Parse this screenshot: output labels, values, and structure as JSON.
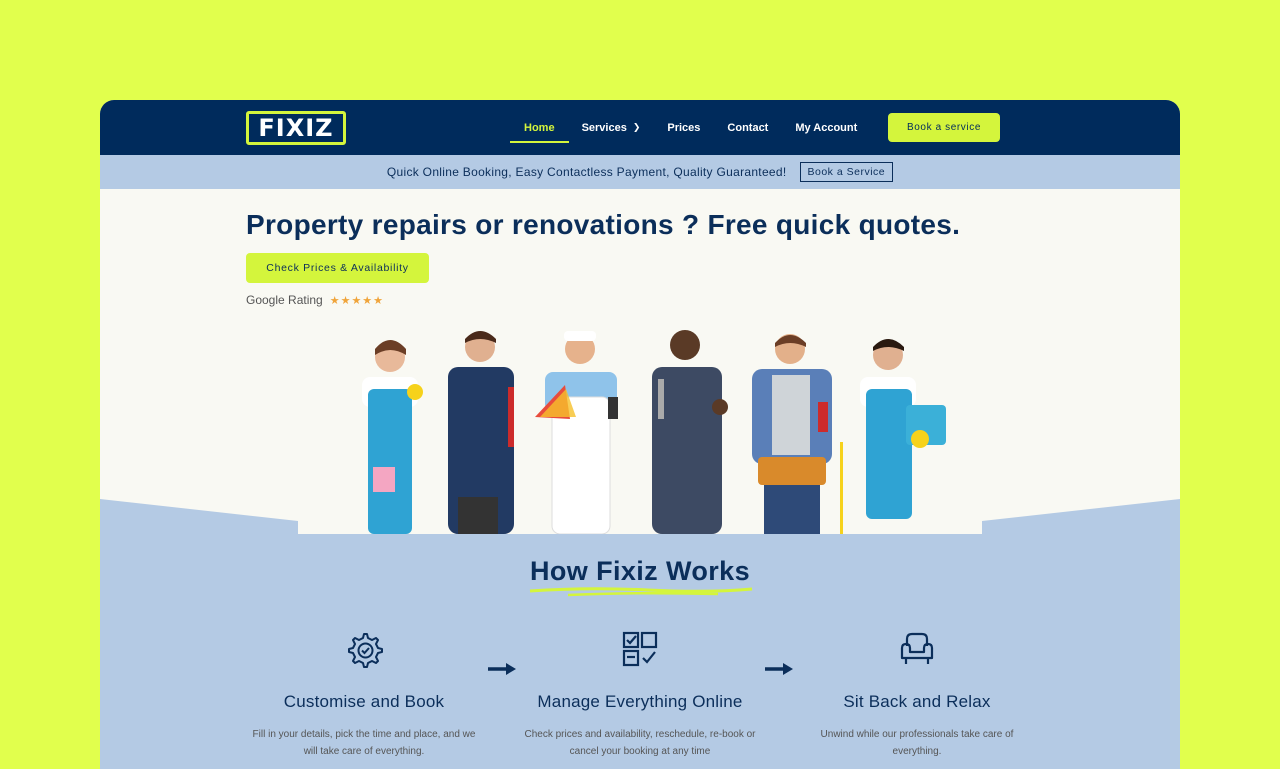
{
  "brand": {
    "logo_text": "FIXIZ"
  },
  "nav": {
    "links": [
      {
        "label": "Home",
        "active": true
      },
      {
        "label": "Services",
        "has_dropdown": true
      },
      {
        "label": "Prices"
      },
      {
        "label": "Contact"
      },
      {
        "label": "My Account"
      }
    ],
    "cta_label": "Book a service"
  },
  "promo": {
    "text": "Quick Online Booking, Easy Contactless Payment, Quality Guaranteed!",
    "button_label": "Book a Service"
  },
  "hero": {
    "title": "Property repairs or renovations ? Free quick quotes.",
    "cta_label": "Check Prices & Availability",
    "rating_label": "Google Rating",
    "rating_stars": "★★★★★"
  },
  "how_it_works": {
    "title": "How Fixiz Works",
    "steps": [
      {
        "icon": "gear-check-icon",
        "title": "Customise and Book",
        "desc": "Fill in your details, pick the time and place, and we will take care of everything."
      },
      {
        "icon": "grid-check-icon",
        "title": "Manage Everything Online",
        "desc": "Check prices and availability, reschedule, re-book or cancel your booking at any time"
      },
      {
        "icon": "armchair-icon",
        "title": "Sit Back and Relax",
        "desc": "Unwind while our professionals take care of everything."
      }
    ]
  },
  "colors": {
    "background": "#e1ff4d",
    "navy": "#002b5c",
    "accent": "#d4f53c",
    "light_blue": "#b4cae4",
    "hero_bg": "#f9f9f3",
    "star": "#f0a43a"
  }
}
